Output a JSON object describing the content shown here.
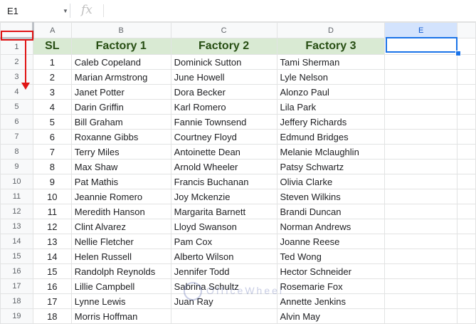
{
  "formula_bar": {
    "name_box": "E1",
    "fx_label": "fx",
    "formula": ""
  },
  "columns": [
    "A",
    "B",
    "C",
    "D",
    "E"
  ],
  "header_row": {
    "row": "1",
    "sl": "SL",
    "f1": "Factory 1",
    "f2": "Factory 2",
    "f3": "Factory 3"
  },
  "rows": [
    {
      "row": "2",
      "sl": "1",
      "f1": "Caleb Copeland",
      "f2": "Dominick Sutton",
      "f3": "Tami Sherman"
    },
    {
      "row": "3",
      "sl": "2",
      "f1": "Marian Armstrong",
      "f2": "June Howell",
      "f3": "Lyle Nelson"
    },
    {
      "row": "4",
      "sl": "3",
      "f1": "Janet Potter",
      "f2": "Dora Becker",
      "f3": "Alonzo Paul"
    },
    {
      "row": "5",
      "sl": "4",
      "f1": "Darin Griffin",
      "f2": "Karl Romero",
      "f3": "Lila Park"
    },
    {
      "row": "6",
      "sl": "5",
      "f1": "Bill Graham",
      "f2": "Fannie Townsend",
      "f3": "Jeffery Richards"
    },
    {
      "row": "7",
      "sl": "6",
      "f1": "Roxanne Gibbs",
      "f2": "Courtney Floyd",
      "f3": "Edmund Bridges"
    },
    {
      "row": "8",
      "sl": "7",
      "f1": "Terry Miles",
      "f2": "Antoinette Dean",
      "f3": "Melanie Mclaughlin"
    },
    {
      "row": "9",
      "sl": "8",
      "f1": "Max Shaw",
      "f2": "Arnold Wheeler",
      "f3": "Patsy Schwartz"
    },
    {
      "row": "10",
      "sl": "9",
      "f1": "Pat Mathis",
      "f2": "Francis Buchanan",
      "f3": "Olivia Clarke"
    },
    {
      "row": "11",
      "sl": "10",
      "f1": "Jeannie Romero",
      "f2": "Joy Mckenzie",
      "f3": "Steven Wilkins"
    },
    {
      "row": "12",
      "sl": "11",
      "f1": "Meredith Hanson",
      "f2": "Margarita Barnett",
      "f3": "Brandi Duncan"
    },
    {
      "row": "13",
      "sl": "12",
      "f1": "Clint Alvarez",
      "f2": "Lloyd Swanson",
      "f3": "Norman Andrews"
    },
    {
      "row": "14",
      "sl": "13",
      "f1": "Nellie Fletcher",
      "f2": "Pam Cox",
      "f3": "Joanne Reese"
    },
    {
      "row": "15",
      "sl": "14",
      "f1": "Helen Russell",
      "f2": "Alberto Wilson",
      "f3": "Ted Wong"
    },
    {
      "row": "16",
      "sl": "15",
      "f1": "Randolph Reynolds",
      "f2": "Jennifer Todd",
      "f3": "Hector Schneider"
    },
    {
      "row": "17",
      "sl": "16",
      "f1": "Lillie Campbell",
      "f2": "Sabrina Schultz",
      "f3": "Rosemarie Fox"
    },
    {
      "row": "18",
      "sl": "17",
      "f1": "Lynne Lewis",
      "f2": "Juan Ray",
      "f3": "Annette Jenkins"
    },
    {
      "row": "19",
      "sl": "18",
      "f1": "Morris Hoffman",
      "f2": "",
      "f3": "Alvin May"
    }
  ],
  "watermark": {
    "text": "OfficeWheel"
  },
  "colors": {
    "header_fill": "#d9ead3",
    "selection": "#1a73e8",
    "annotation": "#e01414"
  }
}
